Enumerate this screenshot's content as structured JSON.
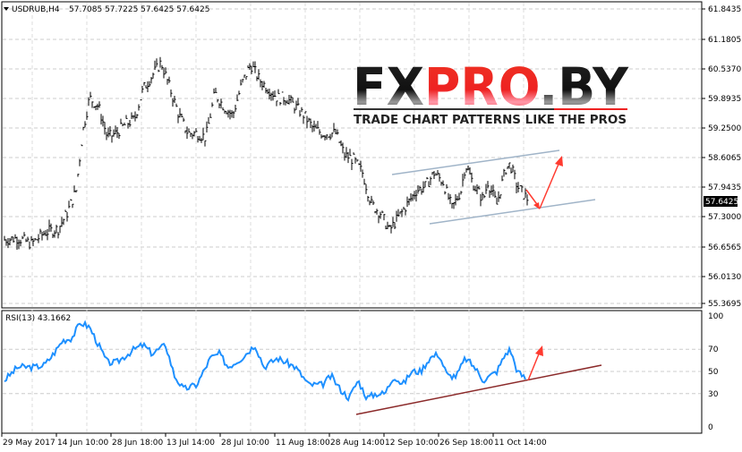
{
  "header": {
    "symbol": "USDRUB,H4",
    "ohlc": "57.7085 57.7225 57.6425 57.6425"
  },
  "rsi_label": "RSI(13) 43.1662",
  "logo": {
    "text_black1": "FX",
    "text_red": "PRO",
    "text_black2": ".BY",
    "tagline": "TRADE CHART PATTERNS LIKE THE PROS"
  },
  "colors": {
    "price": "#000000",
    "rsi": "#1e90ff",
    "trend": "#a0b4c8",
    "arrow": "#ff3b30",
    "rsi_trend": "#8b2a2a"
  },
  "chart_data": [
    {
      "type": "line",
      "title": "USDRUB,H4",
      "ylim": [
        55.3695,
        61.8435
      ],
      "y_ticks": [
        "61.8435",
        "61.1805",
        "60.5370",
        "59.8935",
        "59.2500",
        "58.6065",
        "57.9435",
        "57.3000",
        "56.6565",
        "56.0130",
        "55.3695"
      ],
      "current_price": "57.6425",
      "x_ticks": [
        "29 May 2017",
        "14 Jun 10:00",
        "28 Jun 18:00",
        "13 Jul 14:00",
        "28 Jul 10:00",
        "11 Aug 18:00",
        "28 Aug 14:00",
        "12 Sep 10:00",
        "26 Sep 18:00",
        "11 Oct 14:00"
      ],
      "x": [
        5,
        20,
        35,
        50,
        65,
        75,
        85,
        92,
        100,
        110,
        120,
        130,
        140,
        150,
        160,
        170,
        180,
        190,
        200,
        210,
        220,
        230,
        240,
        250,
        260,
        270,
        280,
        290,
        300,
        310,
        320,
        340,
        350,
        360,
        375,
        385,
        395,
        405,
        415,
        425,
        435,
        445,
        455,
        465,
        475,
        485,
        495,
        505,
        515,
        520,
        530,
        540,
        545,
        555,
        565,
        570,
        578,
        590
      ],
      "close": [
        56.77,
        56.81,
        56.68,
        56.93,
        57.01,
        57.36,
        57.85,
        59.11,
        59.89,
        59.7,
        59.02,
        59.11,
        59.31,
        59.41,
        60.09,
        60.38,
        60.67,
        60.09,
        59.5,
        59.11,
        59.11,
        59.02,
        59.99,
        59.7,
        59.5,
        60.19,
        60.63,
        60.28,
        60.09,
        59.89,
        59.89,
        59.5,
        59.21,
        59.11,
        59.11,
        58.63,
        58.53,
        58.24,
        57.55,
        57.36,
        56.97,
        57.26,
        57.55,
        57.85,
        57.94,
        58.24,
        58.04,
        57.46,
        57.85,
        58.43,
        57.94,
        57.65,
        58.04,
        57.55,
        58.33,
        58.43,
        57.94,
        57.65
      ]
    },
    {
      "type": "line",
      "title": "RSI(13)",
      "ylim": [
        0,
        100
      ],
      "y_ticks": [
        "100",
        "70",
        "50",
        "30",
        "0"
      ],
      "x": [
        5,
        20,
        40,
        50,
        60,
        70,
        80,
        90,
        100,
        110,
        120,
        130,
        150,
        160,
        170,
        185,
        195,
        205,
        220,
        235,
        245,
        255,
        270,
        285,
        295,
        310,
        330,
        345,
        360,
        370,
        380,
        390,
        400,
        410,
        420,
        430,
        440,
        450,
        460,
        470,
        480,
        490,
        500,
        510,
        520,
        530,
        540,
        555,
        565,
        570,
        578,
        588
      ],
      "values": [
        42,
        54,
        54,
        56,
        66,
        78,
        80,
        94,
        90,
        74,
        58,
        58,
        70,
        74,
        66,
        74,
        46,
        34,
        38,
        62,
        66,
        54,
        62,
        74,
        54,
        62,
        54,
        38,
        38,
        46,
        34,
        26,
        42,
        26,
        30,
        30,
        46,
        38,
        50,
        50,
        62,
        66,
        46,
        46,
        62,
        54,
        42,
        50,
        66,
        70,
        50,
        43
      ]
    }
  ]
}
